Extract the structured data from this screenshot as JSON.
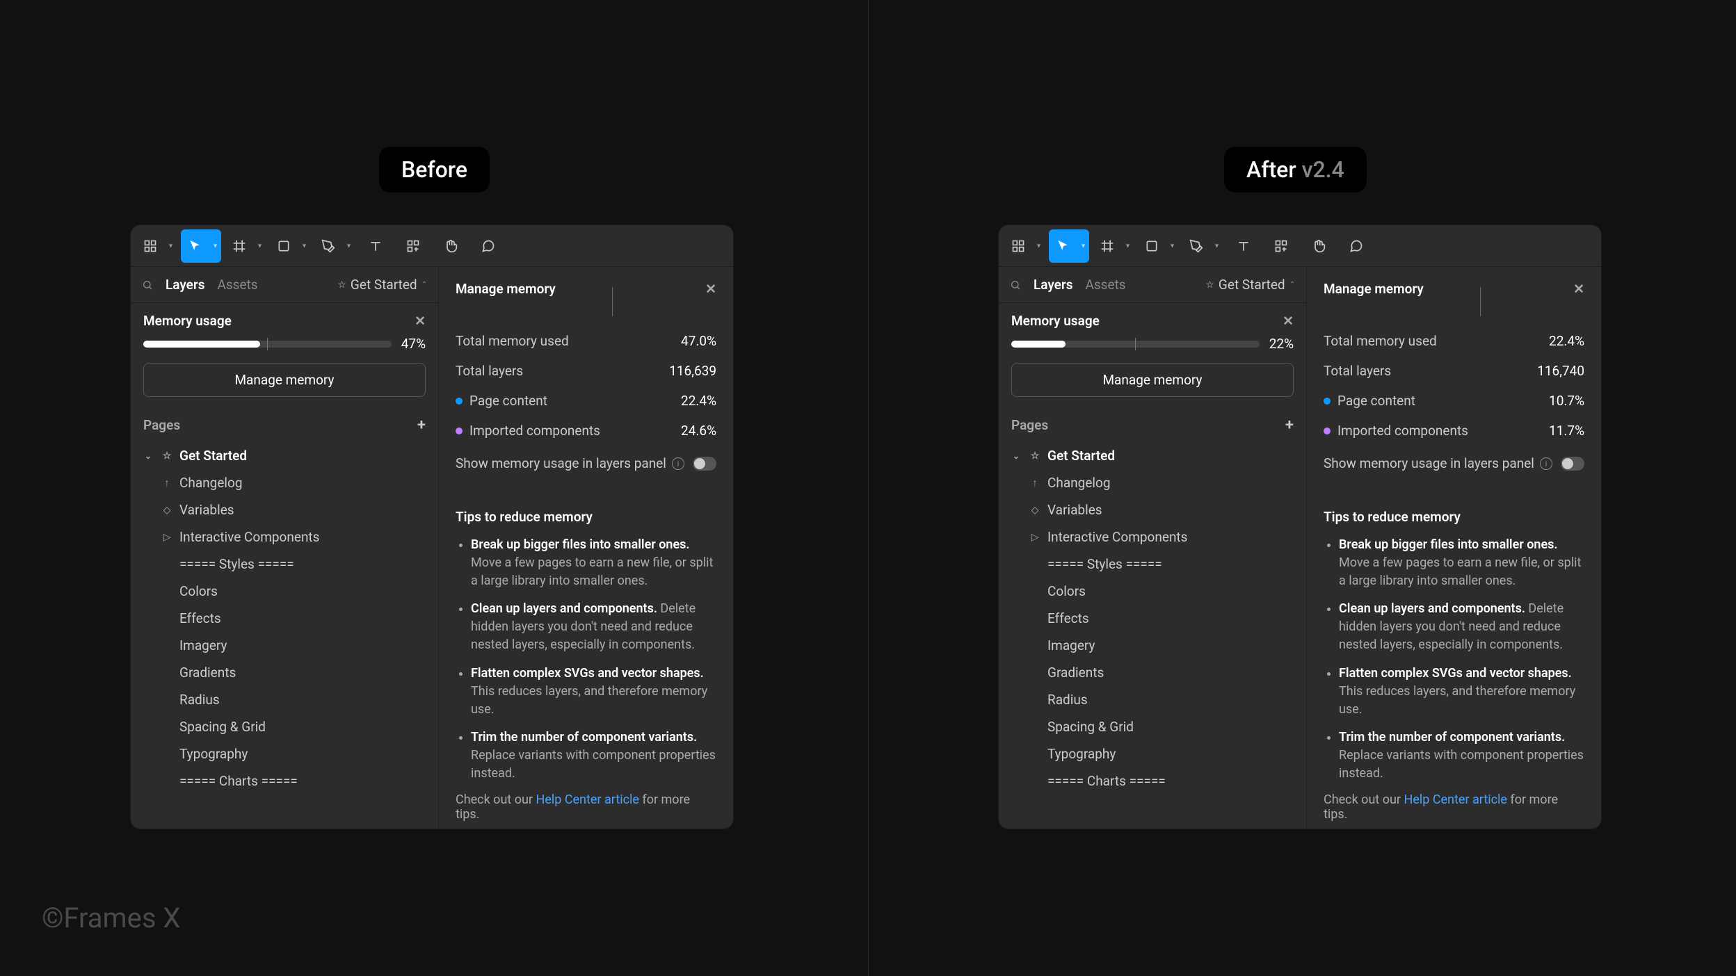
{
  "labels": {
    "before": "Before",
    "after_main": "After ",
    "after_dim": "v2.4"
  },
  "credit": "©Frames X",
  "common": {
    "tabs": {
      "layers": "Layers",
      "assets": "Assets"
    },
    "file_name": "Get Started",
    "memory_usage_label": "Memory usage",
    "manage_memory_btn": "Manage memory",
    "pages_label": "Pages",
    "panel_title": "Manage memory",
    "total_memory_used": "Total memory used",
    "total_layers": "Total layers",
    "page_content": "Page content",
    "imported_components": "Imported components",
    "toggle_label": "Show memory usage in layers panel",
    "tips_title": "Tips to reduce memory",
    "tips": [
      {
        "bold": "Break up bigger files into smaller ones.",
        "rest": " Move a few pages to earn a new file, or split a large library into smaller ones."
      },
      {
        "bold": "Clean up layers and components.",
        "rest": " Delete hidden layers you don't need and reduce nested layers, especially in components."
      },
      {
        "bold": "Flatten complex SVGs and vector shapes.",
        "rest": " This reduces layers, and therefore memory use."
      },
      {
        "bold": "Trim the number of component variants.",
        "rest": " Replace variants with component properties instead."
      }
    ],
    "footer_pre": "Check out our ",
    "footer_link": "Help Center article",
    "footer_post": " for more tips.",
    "pages": [
      {
        "icon": "star",
        "label": "Get Started",
        "current": true
      },
      {
        "icon": "up",
        "label": "Changelog"
      },
      {
        "icon": "diamond",
        "label": "Variables"
      },
      {
        "icon": "play",
        "label": "Interactive Components"
      },
      {
        "icon": "none",
        "label": "=====   Styles   ====="
      },
      {
        "icon": "none",
        "label": "Colors"
      },
      {
        "icon": "none",
        "label": "Effects"
      },
      {
        "icon": "none",
        "label": "Imagery"
      },
      {
        "icon": "none",
        "label": "Gradients"
      },
      {
        "icon": "none",
        "label": "Radius"
      },
      {
        "icon": "none",
        "label": "Spacing & Grid"
      },
      {
        "icon": "none",
        "label": "Typography"
      },
      {
        "icon": "none",
        "label": "=====   Charts   ====="
      }
    ]
  },
  "before": {
    "sidebar_pct": "47%",
    "sidebar_fill_pct": 47,
    "total_memory_val": "47.0%",
    "total_layers_val": "116,639",
    "page_content_val": "22.4%",
    "imported_val": "24.6%",
    "seg_blue_pct": 22.4,
    "seg_purple_pct": 24.6
  },
  "after": {
    "sidebar_pct": "22%",
    "sidebar_fill_pct": 22,
    "total_memory_val": "22.4%",
    "total_layers_val": "116,740",
    "page_content_val": "10.7%",
    "imported_val": "11.7%",
    "seg_blue_pct": 10.7,
    "seg_purple_pct": 11.7
  }
}
